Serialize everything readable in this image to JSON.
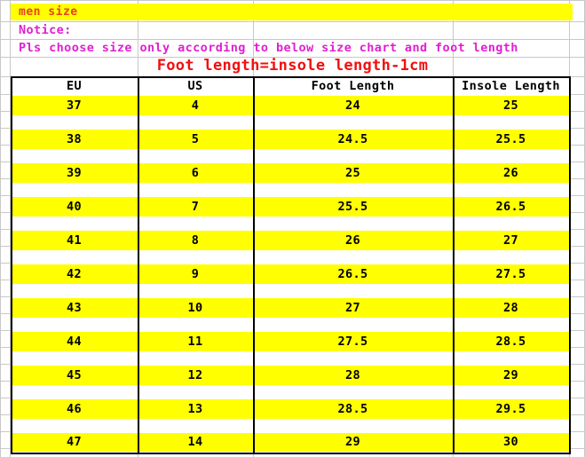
{
  "banner": {
    "label": "men size",
    "background_color": "#ffff00",
    "text_color": "#e8401a"
  },
  "notice": {
    "label": "Notice:",
    "body": "Pls choose size only according to below size chart and foot length",
    "text_color": "#e020d0"
  },
  "formula": {
    "text": "Foot length=insole length-1cm",
    "text_color": "#f01010"
  },
  "table": {
    "columns": [
      "EU",
      "US",
      "Foot Length",
      "Insole Length"
    ],
    "row_band_color": "#ffff00",
    "border_color": "#000000",
    "rows": [
      {
        "eu": "37",
        "us": "4",
        "foot_length": "24",
        "insole_length": "25"
      },
      {
        "eu": "38",
        "us": "5",
        "foot_length": "24.5",
        "insole_length": "25.5"
      },
      {
        "eu": "39",
        "us": "6",
        "foot_length": "25",
        "insole_length": "26"
      },
      {
        "eu": "40",
        "us": "7",
        "foot_length": "25.5",
        "insole_length": "26.5"
      },
      {
        "eu": "41",
        "us": "8",
        "foot_length": "26",
        "insole_length": "27"
      },
      {
        "eu": "42",
        "us": "9",
        "foot_length": "26.5",
        "insole_length": "27.5"
      },
      {
        "eu": "43",
        "us": "10",
        "foot_length": "27",
        "insole_length": "28"
      },
      {
        "eu": "44",
        "us": "11",
        "foot_length": "27.5",
        "insole_length": "28.5"
      },
      {
        "eu": "45",
        "us": "12",
        "foot_length": "28",
        "insole_length": "29"
      },
      {
        "eu": "46",
        "us": "13",
        "foot_length": "28.5",
        "insole_length": "29.5"
      },
      {
        "eu": "47",
        "us": "14",
        "foot_length": "29",
        "insole_length": "30"
      }
    ]
  }
}
